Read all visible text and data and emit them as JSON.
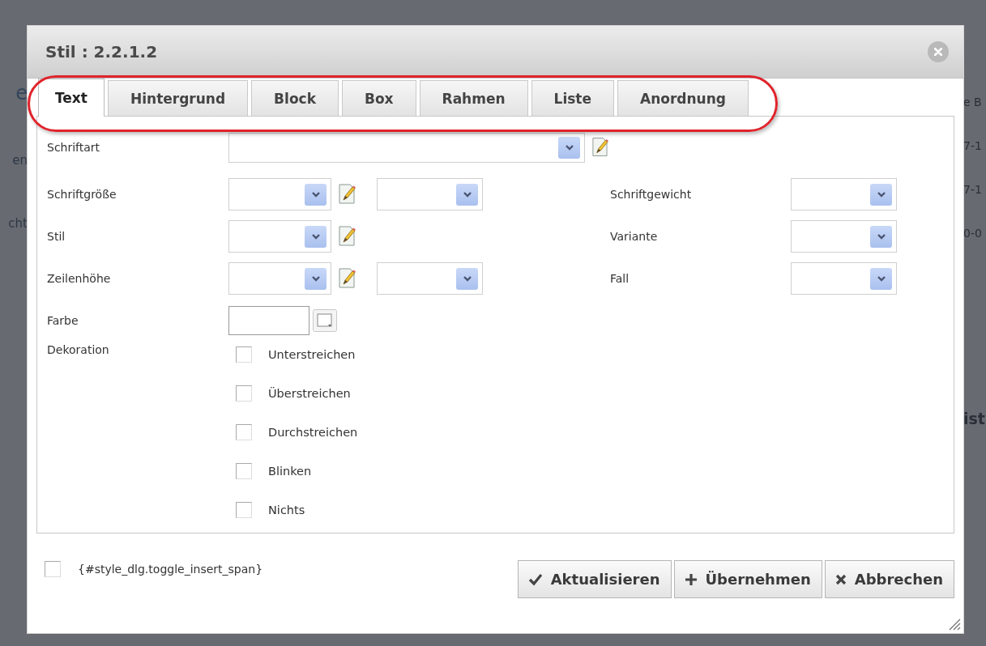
{
  "background": {
    "left_fragments": [
      {
        "text": "e",
        "kind": "heading"
      },
      {
        "text": "en",
        "kind": "plain"
      },
      {
        "text": "cht",
        "kind": "plain"
      }
    ],
    "right_fragments": [
      {
        "text": "e B",
        "kind": "plain"
      },
      {
        "text": "7-1",
        "kind": "plain"
      },
      {
        "text": "7-1",
        "kind": "plain"
      },
      {
        "text": "0-0",
        "kind": "plain"
      },
      {
        "text": "ist",
        "kind": "heading"
      }
    ]
  },
  "dialog": {
    "title": "Stil : 2.2.1.2",
    "tabs": [
      {
        "label": "Text",
        "selected": true
      },
      {
        "label": "Hintergrund",
        "selected": false
      },
      {
        "label": "Block",
        "selected": false
      },
      {
        "label": "Box",
        "selected": false
      },
      {
        "label": "Rahmen",
        "selected": false
      },
      {
        "label": "Liste",
        "selected": false
      },
      {
        "label": "Anordnung",
        "selected": false
      }
    ],
    "rows": [
      {
        "label": "Schriftart",
        "controls": [
          {
            "kind": "wide-select"
          },
          {
            "kind": "edit"
          }
        ]
      },
      {
        "label": "Schriftgröße",
        "controls": [
          {
            "kind": "select"
          },
          {
            "kind": "edit"
          },
          {
            "kind": "select"
          }
        ],
        "right_label": "Schriftgewicht"
      },
      {
        "label": "Stil",
        "controls": [
          {
            "kind": "select"
          },
          {
            "kind": "edit"
          }
        ],
        "right_label": "Variante"
      },
      {
        "label": "Zeilenhöhe",
        "controls": [
          {
            "kind": "select"
          },
          {
            "kind": "edit"
          },
          {
            "kind": "select"
          }
        ],
        "right_label": "Fall"
      },
      {
        "label": "Farbe",
        "controls": [
          {
            "kind": "color"
          }
        ]
      }
    ],
    "decoration": {
      "label": "Dekoration",
      "options": [
        {
          "label": "Unterstreichen",
          "checked": false
        },
        {
          "label": "Überstreichen",
          "checked": false
        },
        {
          "label": "Durchstreichen",
          "checked": false
        },
        {
          "label": "Blinken",
          "checked": false
        },
        {
          "label": "Nichts",
          "checked": false
        }
      ]
    },
    "insert_span": {
      "label": "{#style_dlg.toggle_insert_span}",
      "checked": false
    },
    "buttons": [
      {
        "label": "Aktualisieren",
        "kind": "check"
      },
      {
        "label": "Übernehmen",
        "kind": "plus"
      },
      {
        "label": "Abbrechen",
        "kind": "cross"
      }
    ]
  }
}
